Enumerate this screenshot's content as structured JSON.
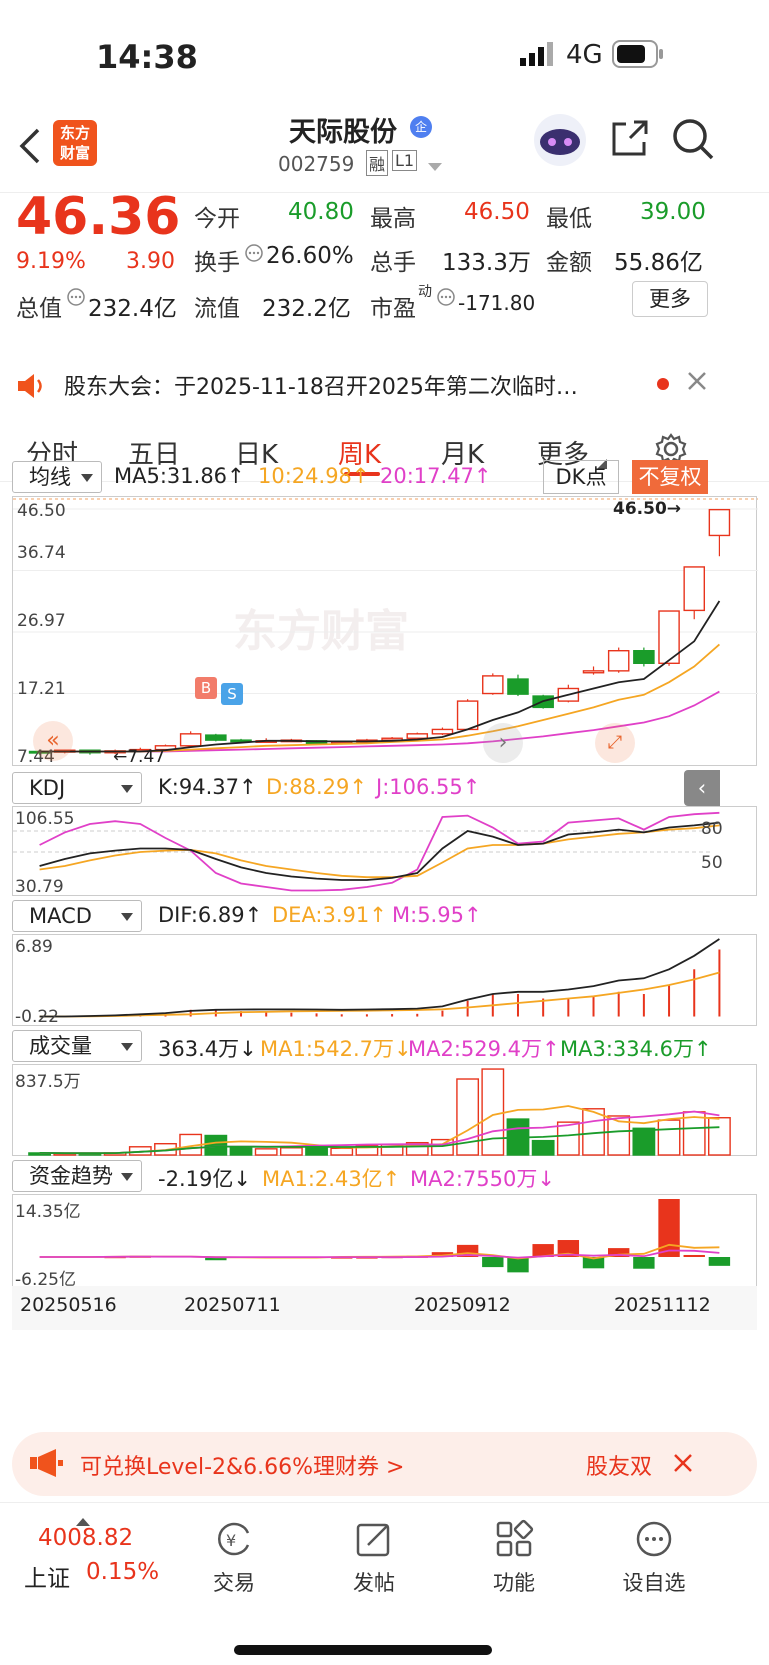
{
  "status": {
    "time": "14:38",
    "network": "4G"
  },
  "header": {
    "logo_line1": "东方",
    "logo_line2": "财富",
    "stock_name": "天际股份",
    "badge": "企",
    "code": "002759",
    "tag_margin": "融",
    "tag_level": "L1"
  },
  "quote": {
    "price": "46.36",
    "change_pct": "9.19%",
    "change": "3.90",
    "open_label": "今开",
    "open": "40.80",
    "high_label": "最高",
    "high": "46.50",
    "low_label": "最低",
    "low": "39.00",
    "turnover_label": "换手",
    "turnover": "26.60%",
    "volume_label": "总手",
    "volume": "133.3万",
    "amount_label": "金额",
    "amount": "55.86亿",
    "mktcap_label": "总值",
    "mktcap": "232.4亿",
    "float_label": "流值",
    "float": "232.2亿",
    "pe_label": "市盈",
    "pe_sup": "动",
    "pe": "-171.80",
    "more_button": "更多"
  },
  "notice": {
    "text": "股东大会：于2025-11-18召开2025年第二次临时…"
  },
  "tabs": [
    "分时",
    "五日",
    "日K",
    "周K",
    "月K",
    "更多"
  ],
  "active_tab": "周K",
  "ma_bar": {
    "selector": "均线",
    "ma5": "MA5:31.86↑",
    "ma10": "10:24.98↑",
    "ma20": "20:17.47↑",
    "dk_button": "DK点",
    "fq_button": "不复权"
  },
  "kdj_bar": {
    "selector": "KDJ",
    "k": "K:94.37↑",
    "d": "D:88.29↑",
    "j": "J:106.55↑"
  },
  "macd_bar": {
    "selector": "MACD",
    "dif": "DIF:6.89↑",
    "dea": "DEA:3.91↑",
    "m": "M:5.95↑"
  },
  "vol_bar": {
    "selector": "成交量",
    "vol": "363.4万↓",
    "ma1": "MA1:542.7万↓",
    "ma2": "MA2:529.4万↑",
    "ma3": "MA3:334.6万↑"
  },
  "fund_bar": {
    "selector": "资金趋势",
    "val": "-2.19亿↓",
    "ma1": "MA1:2.43亿↑",
    "ma2": "MA2:7550万↓"
  },
  "axis": {
    "price": [
      "46.50",
      "36.74",
      "26.97",
      "17.21",
      "7.44"
    ],
    "price_high_marker": "46.50→",
    "price_low_marker": "←7.47",
    "kdj": [
      "106.55",
      "30.79"
    ],
    "kdj_right": [
      "80",
      "50"
    ],
    "macd": [
      "6.89",
      "-0.22"
    ],
    "vol": [
      "837.5万"
    ],
    "fund": [
      "14.35亿",
      "-6.25亿"
    ],
    "dates": [
      "20250516",
      "20250711",
      "20250912",
      "20251112"
    ]
  },
  "markers": {
    "b": "B",
    "s": "S",
    "watermark": "东方财富"
  },
  "banner": {
    "text": "可兑换Level-2&6.66%理财券 >",
    "right": "股友双"
  },
  "bottom_nav": {
    "index_value": "4008.82",
    "index_name": "上证",
    "index_change": "0.15%",
    "items": [
      "交易",
      "发帖",
      "功能",
      "设自选"
    ]
  },
  "chart_data": {
    "type": "candlestick",
    "ylim": [
      7.44,
      46.5
    ],
    "candles": [
      {
        "o": 8.0,
        "c": 7.9,
        "h": 8.1,
        "l": 7.5
      },
      {
        "o": 7.9,
        "c": 8.2,
        "h": 8.3,
        "l": 7.7
      },
      {
        "o": 8.2,
        "c": 7.8,
        "h": 8.3,
        "l": 7.5
      },
      {
        "o": 7.8,
        "c": 8.1,
        "h": 8.3,
        "l": 7.6
      },
      {
        "o": 8.1,
        "c": 8.3,
        "h": 8.6,
        "l": 8.0
      },
      {
        "o": 8.3,
        "c": 8.9,
        "h": 9.1,
        "l": 8.2
      },
      {
        "o": 8.9,
        "c": 10.8,
        "h": 11.2,
        "l": 8.8
      },
      {
        "o": 10.6,
        "c": 9.8,
        "h": 10.8,
        "l": 9.6
      },
      {
        "o": 9.8,
        "c": 9.6,
        "h": 10.0,
        "l": 9.4
      },
      {
        "o": 9.6,
        "c": 9.7,
        "h": 10.1,
        "l": 9.4
      },
      {
        "o": 9.7,
        "c": 9.8,
        "h": 10.0,
        "l": 9.5
      },
      {
        "o": 9.7,
        "c": 9.3,
        "h": 9.8,
        "l": 9.1
      },
      {
        "o": 9.3,
        "c": 9.5,
        "h": 9.7,
        "l": 9.1
      },
      {
        "o": 9.5,
        "c": 9.8,
        "h": 10.0,
        "l": 9.3
      },
      {
        "o": 9.8,
        "c": 10.1,
        "h": 10.3,
        "l": 9.6
      },
      {
        "o": 10.1,
        "c": 10.8,
        "h": 11.0,
        "l": 10.0
      },
      {
        "o": 10.8,
        "c": 11.5,
        "h": 11.8,
        "l": 10.6
      },
      {
        "o": 11.5,
        "c": 16.0,
        "h": 16.3,
        "l": 11.4
      },
      {
        "o": 17.2,
        "c": 20.0,
        "h": 20.4,
        "l": 17.0
      },
      {
        "o": 19.5,
        "c": 17.1,
        "h": 20.2,
        "l": 16.8
      },
      {
        "o": 16.8,
        "c": 15.0,
        "h": 17.0,
        "l": 14.8
      },
      {
        "o": 16.0,
        "c": 18.0,
        "h": 18.6,
        "l": 15.8
      },
      {
        "o": 20.5,
        "c": 20.8,
        "h": 21.5,
        "l": 20.2
      },
      {
        "o": 20.8,
        "c": 24.0,
        "h": 24.5,
        "l": 20.5
      },
      {
        "o": 24.0,
        "c": 22.0,
        "h": 24.5,
        "l": 21.5
      },
      {
        "o": 22.0,
        "c": 30.3,
        "h": 30.3,
        "l": 21.6
      },
      {
        "o": 30.4,
        "c": 37.3,
        "h": 37.3,
        "l": 29.0
      },
      {
        "o": 42.3,
        "c": 46.4,
        "h": 46.5,
        "l": 39.0
      }
    ],
    "ma5": [
      8.0,
      8.0,
      8.0,
      8.0,
      8.0,
      8.2,
      8.7,
      9.1,
      9.4,
      9.7,
      9.7,
      9.6,
      9.6,
      9.6,
      9.7,
      9.9,
      10.3,
      11.5,
      13.0,
      14.2,
      16.0,
      17.0,
      18.0,
      19.0,
      19.5,
      22.5,
      25.5,
      31.9
    ],
    "ma10": [
      8.0,
      8.0,
      8.0,
      8.0,
      8.0,
      8.1,
      8.3,
      8.5,
      8.7,
      8.9,
      9.0,
      9.1,
      9.2,
      9.3,
      9.5,
      9.7,
      9.9,
      10.5,
      11.2,
      12.0,
      13.0,
      14.0,
      15.0,
      16.2,
      17.0,
      19.0,
      21.5,
      25.0
    ],
    "ma20": [
      8.0,
      8.0,
      8.0,
      8.0,
      8.0,
      8.0,
      8.1,
      8.2,
      8.3,
      8.4,
      8.5,
      8.6,
      8.7,
      8.8,
      8.9,
      9.0,
      9.1,
      9.3,
      9.6,
      10.0,
      10.4,
      10.9,
      11.4,
      12.0,
      12.6,
      13.6,
      15.3,
      17.5
    ],
    "kdj_k": [
      0.3,
      0.4,
      0.48,
      0.52,
      0.55,
      0.55,
      0.53,
      0.4,
      0.28,
      0.2,
      0.15,
      0.12,
      0.1,
      0.1,
      0.13,
      0.2,
      0.55,
      0.8,
      0.72,
      0.6,
      0.62,
      0.75,
      0.78,
      0.82,
      0.78,
      0.85,
      0.88,
      0.92
    ],
    "kdj_d": [
      0.25,
      0.3,
      0.38,
      0.45,
      0.5,
      0.52,
      0.53,
      0.48,
      0.38,
      0.3,
      0.25,
      0.2,
      0.16,
      0.14,
      0.14,
      0.16,
      0.35,
      0.55,
      0.6,
      0.6,
      0.62,
      0.68,
      0.72,
      0.76,
      0.78,
      0.82,
      0.84,
      0.88
    ],
    "kdj_j": [
      0.6,
      0.78,
      0.9,
      0.94,
      0.9,
      0.7,
      0.52,
      0.2,
      0.05,
      0.0,
      -0.05,
      -0.05,
      -0.04,
      0.0,
      0.06,
      0.25,
      1.0,
      1.02,
      0.85,
      0.62,
      0.65,
      0.92,
      0.95,
      0.98,
      0.82,
      1.0,
      1.04,
      1.06
    ],
    "macd_dif": [
      0,
      0,
      0.05,
      0.1,
      0.2,
      0.3,
      0.5,
      0.6,
      0.62,
      0.63,
      0.63,
      0.62,
      0.6,
      0.62,
      0.65,
      0.7,
      0.9,
      1.5,
      2.0,
      2.2,
      2.2,
      2.4,
      2.7,
      3.2,
      3.4,
      4.2,
      5.4,
      6.89
    ],
    "macd_dea": [
      0,
      0,
      0.02,
      0.05,
      0.1,
      0.15,
      0.2,
      0.3,
      0.38,
      0.42,
      0.46,
      0.48,
      0.5,
      0.52,
      0.54,
      0.58,
      0.64,
      0.8,
      1.0,
      1.2,
      1.4,
      1.6,
      1.8,
      2.1,
      2.4,
      2.8,
      3.3,
      3.91
    ],
    "volume": [
      20,
      15,
      18,
      22,
      80,
      110,
      200,
      190,
      80,
      60,
      70,
      80,
      65,
      90,
      100,
      120,
      150,
      740,
      837,
      350,
      140,
      320,
      450,
      380,
      260,
      340,
      420,
      363
    ],
    "fund": [
      0,
      0,
      0,
      0.2,
      0.3,
      0,
      0,
      -0.8,
      0,
      0,
      0,
      0,
      0.1,
      0.1,
      0.2,
      0.3,
      1.2,
      3.0,
      -2.5,
      -3.8,
      3.2,
      4.2,
      -2.8,
      2.2,
      -2.9,
      14.35,
      0.5,
      -2.19
    ]
  }
}
